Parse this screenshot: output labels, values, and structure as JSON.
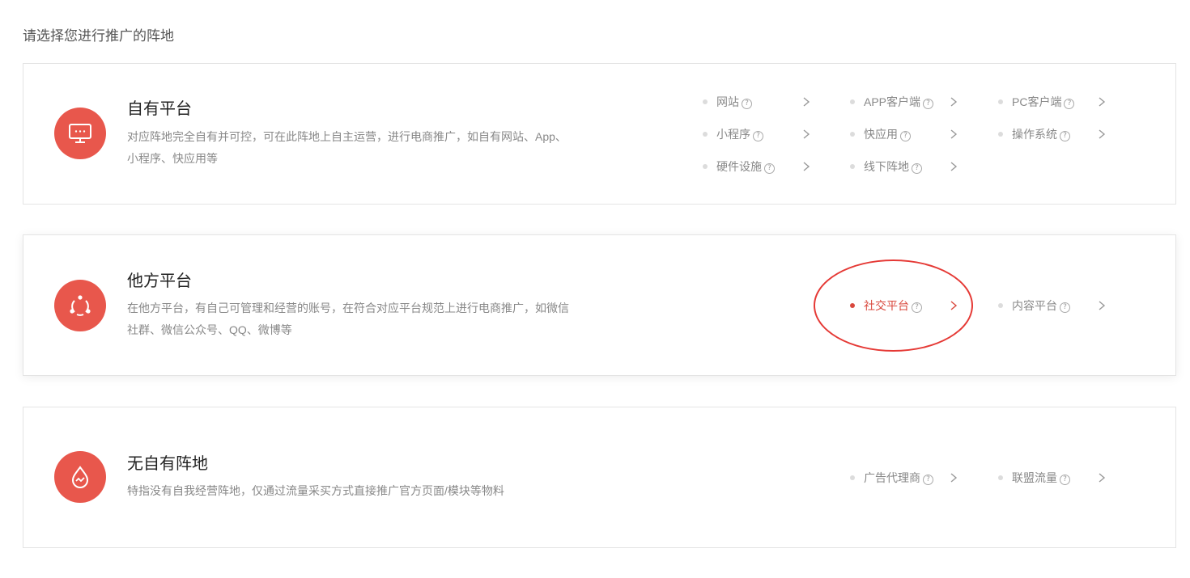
{
  "heading": "请选择您进行推广的阵地",
  "colors": {
    "accent": "#e8574c",
    "active": "#d9483d",
    "highlight": "#e53935"
  },
  "cards": [
    {
      "title": "自有平台",
      "desc_line1": "对应阵地完全自有并可控，可在此阵地上自主运营，进行电商推广，如自有网站、App、",
      "desc_line2": "小程序、快应用等",
      "icon": "monitor-icon",
      "options": [
        {
          "label": "网站"
        },
        {
          "label": "APP客户端"
        },
        {
          "label": "PC客户端"
        },
        {
          "label": "小程序"
        },
        {
          "label": "快应用"
        },
        {
          "label": "操作系统"
        },
        {
          "label": "硬件设施"
        },
        {
          "label": "线下阵地"
        }
      ]
    },
    {
      "title": "他方平台",
      "desc_line1": "在他方平台，有自己可管理和经营的账号，在符合对应平台规范上进行电商推广，如微信",
      "desc_line2": "社群、微信公众号、QQ、微博等",
      "icon": "share-network-icon",
      "options": [
        {
          "label": "社交平台",
          "active": true
        },
        {
          "label": "内容平台"
        }
      ]
    },
    {
      "title": "无自有阵地",
      "desc_line1": "特指没有自我经营阵地，仅通过流量采买方式直接推广官方页面/模块等物料",
      "icon": "traffic-drop-icon",
      "options": [
        {
          "label": "广告代理商"
        },
        {
          "label": "联盟流量"
        }
      ]
    }
  ]
}
